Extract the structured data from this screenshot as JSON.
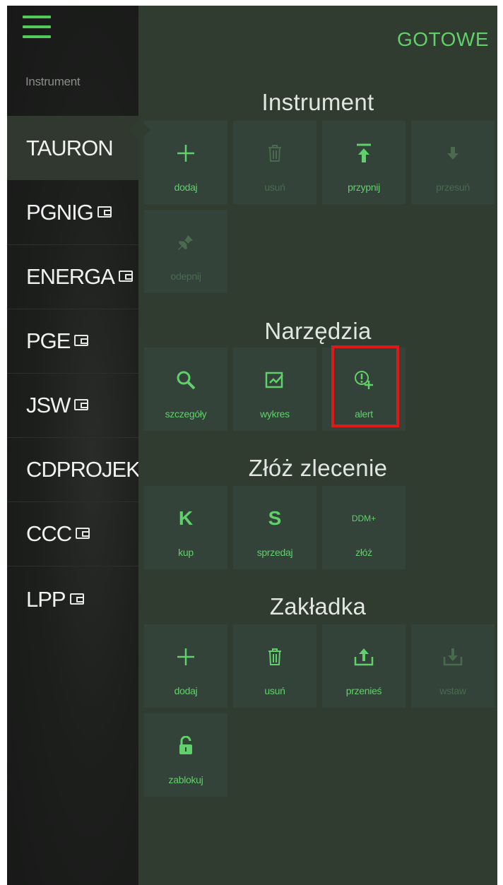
{
  "header": {
    "done_label": "GOTOWE"
  },
  "list": {
    "header": "Instrument",
    "items": [
      {
        "name": "TAURON",
        "wallet": false,
        "selected": true
      },
      {
        "name": "PGNIG",
        "wallet": true
      },
      {
        "name": "ENERGA",
        "wallet": true
      },
      {
        "name": "PGE",
        "wallet": true
      },
      {
        "name": "JSW",
        "wallet": true
      },
      {
        "name": "CDPROJEKT",
        "wallet": false
      },
      {
        "name": "CCC",
        "wallet": true
      },
      {
        "name": "LPP",
        "wallet": true
      }
    ]
  },
  "sections": {
    "instrument": {
      "title": "Instrument",
      "tiles": [
        {
          "label": "dodaj",
          "icon": "plus-icon",
          "enabled": true
        },
        {
          "label": "usuń",
          "icon": "trash-icon",
          "enabled": false
        },
        {
          "label": "przypnij",
          "icon": "pin-top-icon",
          "enabled": true
        },
        {
          "label": "przesuń",
          "icon": "arrow-down-icon",
          "enabled": false
        },
        {
          "label": "odepnij",
          "icon": "unpin-icon",
          "enabled": false
        }
      ]
    },
    "tools": {
      "title": "Narzędzia",
      "tiles": [
        {
          "label": "szczegóły",
          "icon": "magnifier-icon",
          "enabled": true
        },
        {
          "label": "wykres",
          "icon": "chart-icon",
          "enabled": true
        },
        {
          "label": "alert",
          "icon": "alert-add-icon",
          "enabled": true,
          "highlighted": true
        }
      ]
    },
    "order": {
      "title": "Złóż zlecenie",
      "tiles": [
        {
          "label": "kup",
          "glyph": "K",
          "enabled": true
        },
        {
          "label": "sprzedaj",
          "glyph": "S",
          "enabled": true
        },
        {
          "label": "złóż",
          "glyph": "DDM+",
          "enabled": true
        }
      ]
    },
    "tab": {
      "title": "Zakładka",
      "tiles": [
        {
          "label": "dodaj",
          "icon": "plus-icon",
          "enabled": true
        },
        {
          "label": "usuń",
          "icon": "trash-icon",
          "enabled": true
        },
        {
          "label": "przenieś",
          "icon": "upload-icon",
          "enabled": true
        },
        {
          "label": "wstaw",
          "icon": "download-icon",
          "enabled": false
        },
        {
          "label": "zablokuj",
          "icon": "lock-icon",
          "enabled": true
        }
      ]
    }
  },
  "colors": {
    "accent": "#5fd06a",
    "highlight": "#e01818",
    "panel": "#2f3c2f",
    "tile": "#34433a",
    "list_bg": "#1c1f1c"
  }
}
